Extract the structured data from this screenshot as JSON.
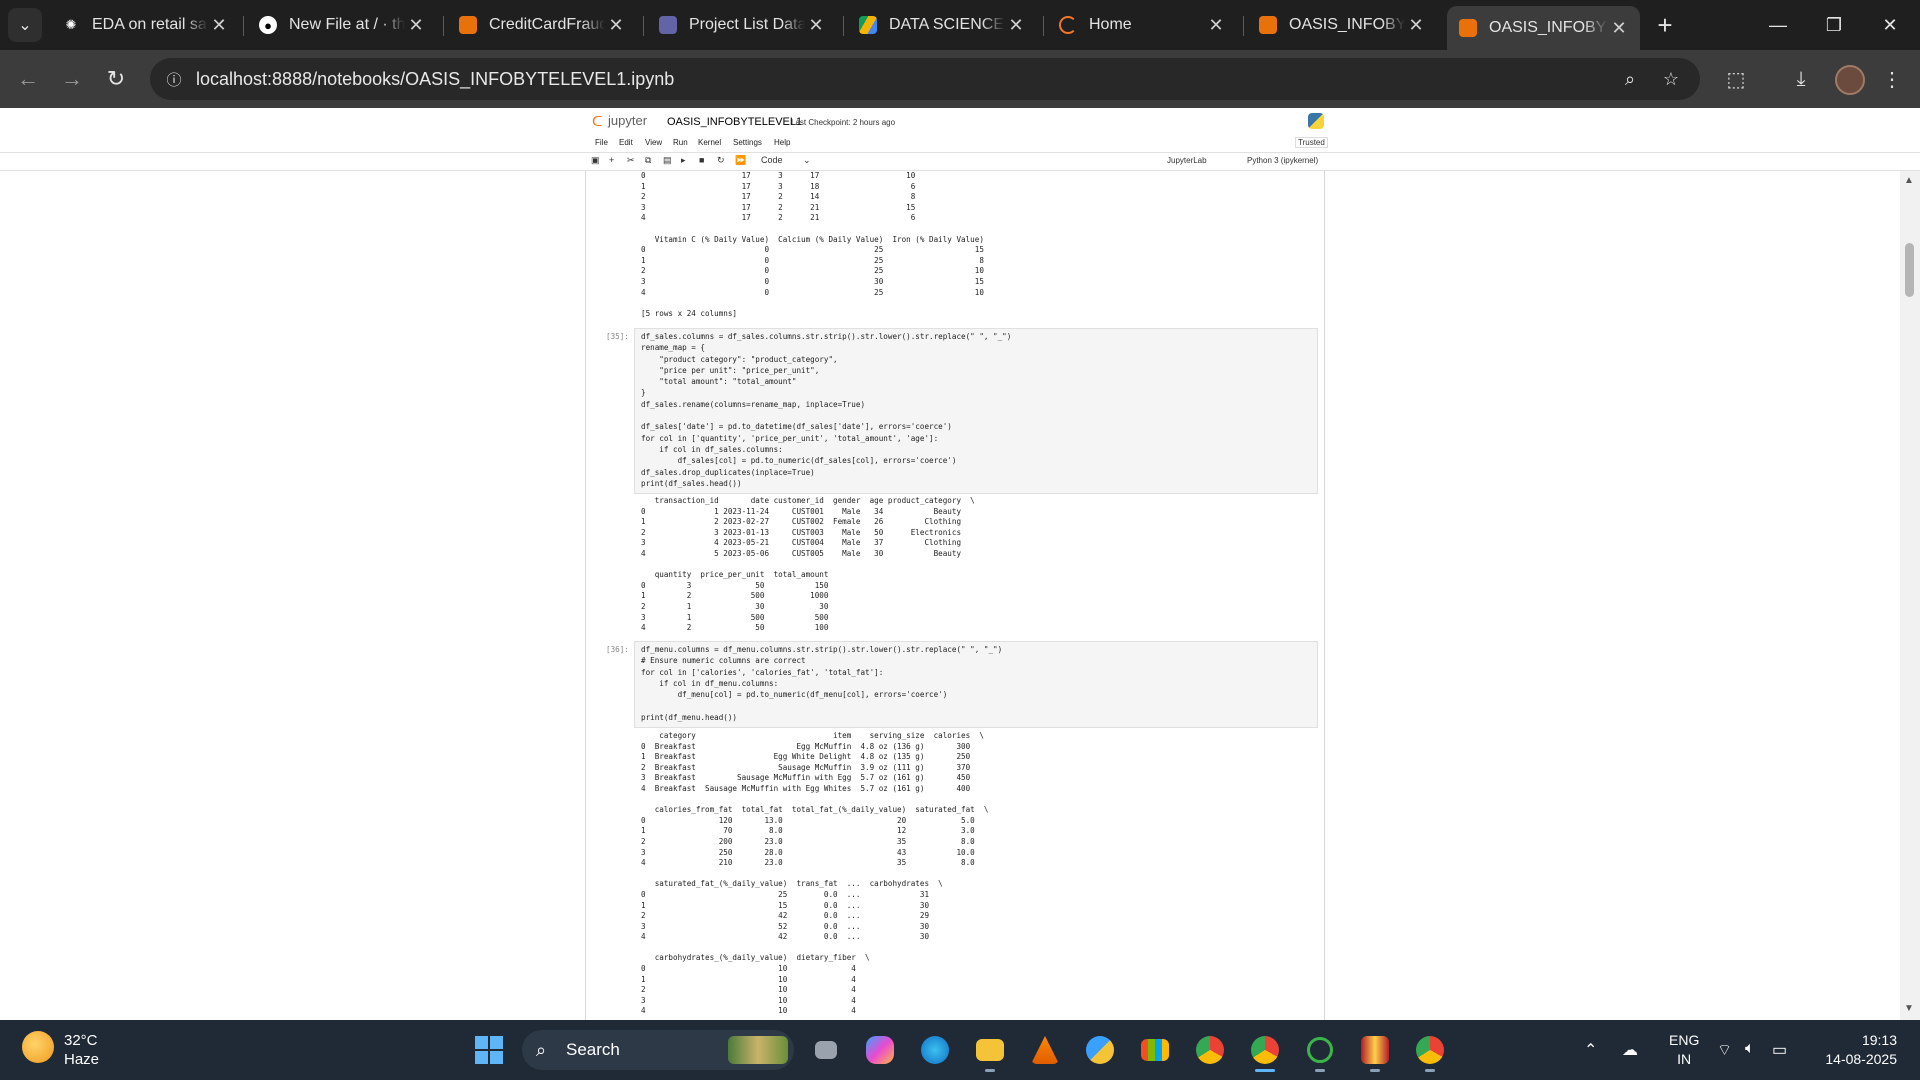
{
  "browser": {
    "tabs": [
      {
        "title": "EDA on retail sal",
        "icon": "openai-icon"
      },
      {
        "title": "New File at / · th",
        "icon": "github-icon"
      },
      {
        "title": "CreditCardFraud",
        "icon": "notebook-icon"
      },
      {
        "title": "Project List Data",
        "icon": "teams-icon"
      },
      {
        "title": "DATA SCIENCE T/",
        "icon": "drive-icon"
      },
      {
        "title": "Home",
        "icon": "loading-icon"
      },
      {
        "title": "OASIS_INFOBYTE",
        "icon": "notebook-icon"
      },
      {
        "title": "OASIS_INFOBYTE",
        "icon": "notebook-icon"
      }
    ],
    "url": "localhost:8888/notebooks/OASIS_INFOBYTELEVEL1.ipynb"
  },
  "jupyter": {
    "brand": "jupyter",
    "notebook_name": "OASIS_INFOBYTELEVEL1",
    "checkpoint": "Last Checkpoint: 2 hours ago",
    "menu": [
      "File",
      "Edit",
      "View",
      "Run",
      "Kernel",
      "Settings",
      "Help"
    ],
    "trusted": "Trusted",
    "cell_type": "Code",
    "jupyterlab": "JupyterLab",
    "kernel": "Python 3 (ipykernel)"
  },
  "cells": {
    "out_top": "0                     17      3      17                   10\n1                     17      3      18                    6\n2                     17      2      14                    8\n3                     17      2      21                   15\n4                     17      2      21                    6\n\n   Vitamin C (% Daily Value)  Calcium (% Daily Value)  Iron (% Daily Value)\n0                          0                       25                    15\n1                          0                       25                     8\n2                          0                       25                    10\n3                          0                       30                    15\n4                          0                       25                    10\n\n[5 rows x 24 columns]",
    "prompt_35": "[35]:",
    "code_35": "df_sales.columns = df_sales.columns.str.strip().str.lower().str.replace(\" \", \"_\")\nrename_map = {\n    \"product category\": \"product_category\",\n    \"price per unit\": \"price_per_unit\",\n    \"total amount\": \"total_amount\"\n}\ndf_sales.rename(columns=rename_map, inplace=True)\n\ndf_sales['date'] = pd.to_datetime(df_sales['date'], errors='coerce')\nfor col in ['quantity', 'price_per_unit', 'total_amount', 'age']:\n    if col in df_sales.columns:\n        df_sales[col] = pd.to_numeric(df_sales[col], errors='coerce')\ndf_sales.drop_duplicates(inplace=True)\nprint(df_sales.head())",
    "out_35": "   transaction_id       date customer_id  gender  age product_category  \\\n0               1 2023-11-24     CUST001    Male   34           Beauty\n1               2 2023-02-27     CUST002  Female   26         Clothing\n2               3 2023-01-13     CUST003    Male   50      Electronics\n3               4 2023-05-21     CUST004    Male   37         Clothing\n4               5 2023-05-06     CUST005    Male   30           Beauty\n\n   quantity  price_per_unit  total_amount\n0         3              50           150\n1         2             500          1000\n2         1              30            30\n3         1             500           500\n4         2              50           100",
    "prompt_36": "[36]:",
    "code_36": "df_menu.columns = df_menu.columns.str.strip().str.lower().str.replace(\" \", \"_\")\n# Ensure numeric columns are correct\nfor col in ['calories', 'calories_fat', 'total_fat']:\n    if col in df_menu.columns:\n        df_menu[col] = pd.to_numeric(df_menu[col], errors='coerce')\n\nprint(df_menu.head())",
    "out_36": "    category                              item    serving_size  calories  \\\n0  Breakfast                      Egg McMuffin  4.8 oz (136 g)       300\n1  Breakfast                 Egg White Delight  4.8 oz (135 g)       250\n2  Breakfast                  Sausage McMuffin  3.9 oz (111 g)       370\n3  Breakfast         Sausage McMuffin with Egg  5.7 oz (161 g)       450\n4  Breakfast  Sausage McMuffin with Egg Whites  5.7 oz (161 g)       400\n\n   calories_from_fat  total_fat  total_fat_(%_daily_value)  saturated_fat  \\\n0                120       13.0                         20            5.0\n1                 70        8.0                         12            3.0\n2                200       23.0                         35            8.0\n3                250       28.0                         43           10.0\n4                210       23.0                         35            8.0\n\n   saturated_fat_(%_daily_value)  trans_fat  ...  carbohydrates  \\\n0                             25        0.0  ...             31\n1                             15        0.0  ...             30\n2                             42        0.0  ...             29\n3                             52        0.0  ...             30\n4                             42        0.0  ...             30\n\n   carbohydrates_(%_daily_value)  dietary_fiber  \\\n0                             10              4\n1                             10              4\n2                             10              4\n3                             10              4\n4                             10              4"
  },
  "taskbar": {
    "temperature": "32°C",
    "weather": "Haze",
    "search": "Search",
    "lang1": "ENG",
    "lang2": "IN",
    "time": "19:13",
    "date": "14-08-2025"
  }
}
